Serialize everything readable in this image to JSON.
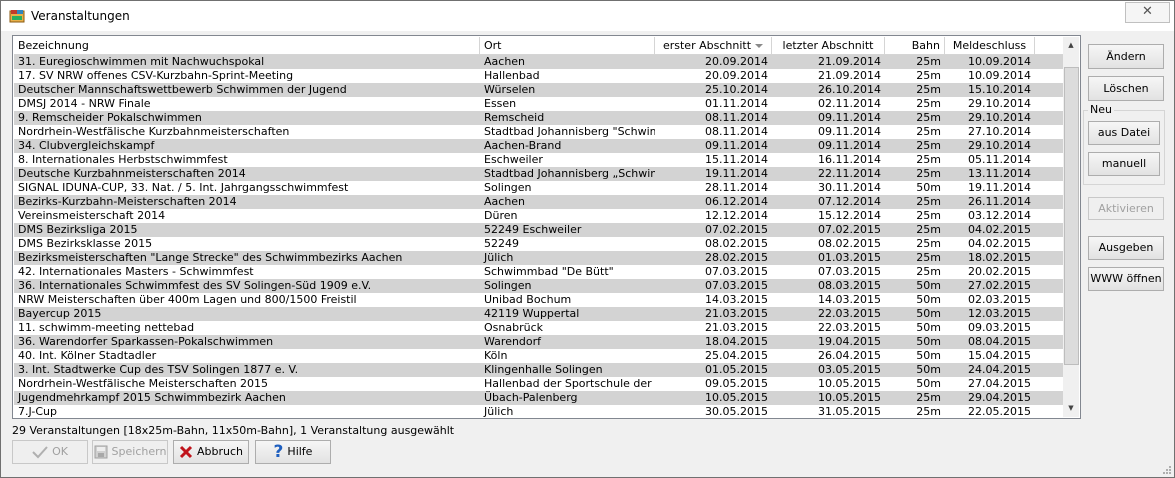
{
  "window": {
    "title": "Veranstaltungen",
    "close_label": "✕"
  },
  "table": {
    "columns": [
      "Bezeichnung",
      "Ort",
      "erster Abschnitt",
      "letzter Abschnitt",
      "Bahn",
      "Meldeschluss"
    ],
    "rows": [
      [
        "31. Euregioschwimmen mit Nachwuchspokal",
        "Aachen",
        "20.09.2014",
        "21.09.2014",
        "25m",
        "10.09.2014"
      ],
      [
        "17. SV NRW offenes CSV-Kurzbahn-Sprint-Meeting",
        "Hallenbad",
        "20.09.2014",
        "21.09.2014",
        "25m",
        "10.09.2014"
      ],
      [
        "Deutscher Mannschaftswettbewerb Schwimmen der Jugend",
        "Würselen",
        "25.10.2014",
        "26.10.2014",
        "25m",
        "15.10.2014"
      ],
      [
        "DMSJ 2014 - NRW Finale",
        "Essen",
        "01.11.2014",
        "02.11.2014",
        "25m",
        "29.10.2014"
      ],
      [
        "9. Remscheider Pokalschwimmen",
        "Remscheid",
        "08.11.2014",
        "09.11.2014",
        "25m",
        "29.10.2014"
      ],
      [
        "Nordrhein-Westfälische Kurzbahnmeisterschaften",
        "Stadtbad Johannisberg \"Schwimm",
        "08.11.2014",
        "09.11.2014",
        "25m",
        "27.10.2014"
      ],
      [
        "34. Clubvergleichskampf",
        "Aachen-Brand",
        "09.11.2014",
        "09.11.2014",
        "25m",
        "29.10.2014"
      ],
      [
        "8. Internationales Herbstschwimmfest",
        "Eschweiler",
        "15.11.2014",
        "16.11.2014",
        "25m",
        "05.11.2014"
      ],
      [
        "Deutsche Kurzbahnmeisterschaften 2014",
        "Stadtbad Johannisberg „Schwimm",
        "19.11.2014",
        "22.11.2014",
        "25m",
        "13.11.2014"
      ],
      [
        "SIGNAL IDUNA-CUP, 33. Nat. / 5. Int. Jahrgangsschwimmfest",
        "Solingen",
        "28.11.2014",
        "30.11.2014",
        "50m",
        "19.11.2014"
      ],
      [
        "Bezirks-Kurzbahn-Meisterschaften 2014",
        "Aachen",
        "06.12.2014",
        "07.12.2014",
        "25m",
        "26.11.2014"
      ],
      [
        "Vereinsmeisterschaft 2014",
        "Düren",
        "12.12.2014",
        "15.12.2014",
        "25m",
        "03.12.2014"
      ],
      [
        "DMS Bezirksliga 2015",
        "52249 Eschweiler",
        "07.02.2015",
        "07.02.2015",
        "25m",
        "04.02.2015"
      ],
      [
        "DMS Bezirksklasse 2015",
        "52249",
        "08.02.2015",
        "08.02.2015",
        "25m",
        "04.02.2015"
      ],
      [
        "Bezirksmeisterschaften \"Lange Strecke\" des Schwimmbezirks Aachen",
        "Jülich",
        "28.02.2015",
        "01.03.2015",
        "25m",
        "18.02.2015"
      ],
      [
        "42. Internationales Masters - Schwimmfest",
        "Schwimmbad \"De Bütt\"",
        "07.03.2015",
        "07.03.2015",
        "25m",
        "20.02.2015"
      ],
      [
        "36. Internationales Schwimmfest des SV Solingen-Süd 1909 e.V.",
        "Solingen",
        "07.03.2015",
        "08.03.2015",
        "50m",
        "27.02.2015"
      ],
      [
        "NRW Meisterschaften über 400m Lagen und 800/1500 Freistil",
        "Unibad Bochum",
        "14.03.2015",
        "14.03.2015",
        "50m",
        "02.03.2015"
      ],
      [
        "Bayercup 2015",
        "42119 Wuppertal",
        "21.03.2015",
        "22.03.2015",
        "50m",
        "12.03.2015"
      ],
      [
        "11. schwimm-meeting nettebad",
        "Osnabrück",
        "21.03.2015",
        "22.03.2015",
        "50m",
        "09.03.2015"
      ],
      [
        "36. Warendorfer Sparkassen-Pokalschwimmen",
        "Warendorf",
        "18.04.2015",
        "19.04.2015",
        "50m",
        "08.04.2015"
      ],
      [
        "40. Int. Kölner Stadtadler",
        "Köln",
        "25.04.2015",
        "26.04.2015",
        "50m",
        "15.04.2015"
      ],
      [
        "3. Int. Stadtwerke Cup des TSV Solingen 1877 e. V.",
        "Klingenhalle Solingen",
        "01.05.2015",
        "03.05.2015",
        "50m",
        "24.04.2015"
      ],
      [
        "Nordrhein-Westfälische Meisterschaften 2015",
        "Hallenbad der Sportschule der",
        "09.05.2015",
        "10.05.2015",
        "50m",
        "27.04.2015"
      ],
      [
        "Jugendmehrkampf 2015 Schwimmbezirk Aachen",
        "Übach-Palenberg",
        "10.05.2015",
        "10.05.2015",
        "25m",
        "29.04.2015"
      ],
      [
        "7.J-Cup",
        "Jülich",
        "30.05.2015",
        "31.05.2015",
        "25m",
        "22.05.2015"
      ]
    ]
  },
  "side_buttons": {
    "edit": "Ändern",
    "delete": "Löschen",
    "new_group_label": "Neu",
    "from_file": "aus Datei",
    "manual": "manuell",
    "activate": "Aktivieren",
    "output": "Ausgeben",
    "open_www": "WWW öffnen"
  },
  "status_text": "29 Veranstaltungen [18x25m-Bahn, 11x50m-Bahn], 1 Veranstaltung ausgewählt",
  "bottom_buttons": {
    "ok": "OK",
    "save": "Speichern",
    "cancel": "Abbruch",
    "help": "Hilfe"
  }
}
